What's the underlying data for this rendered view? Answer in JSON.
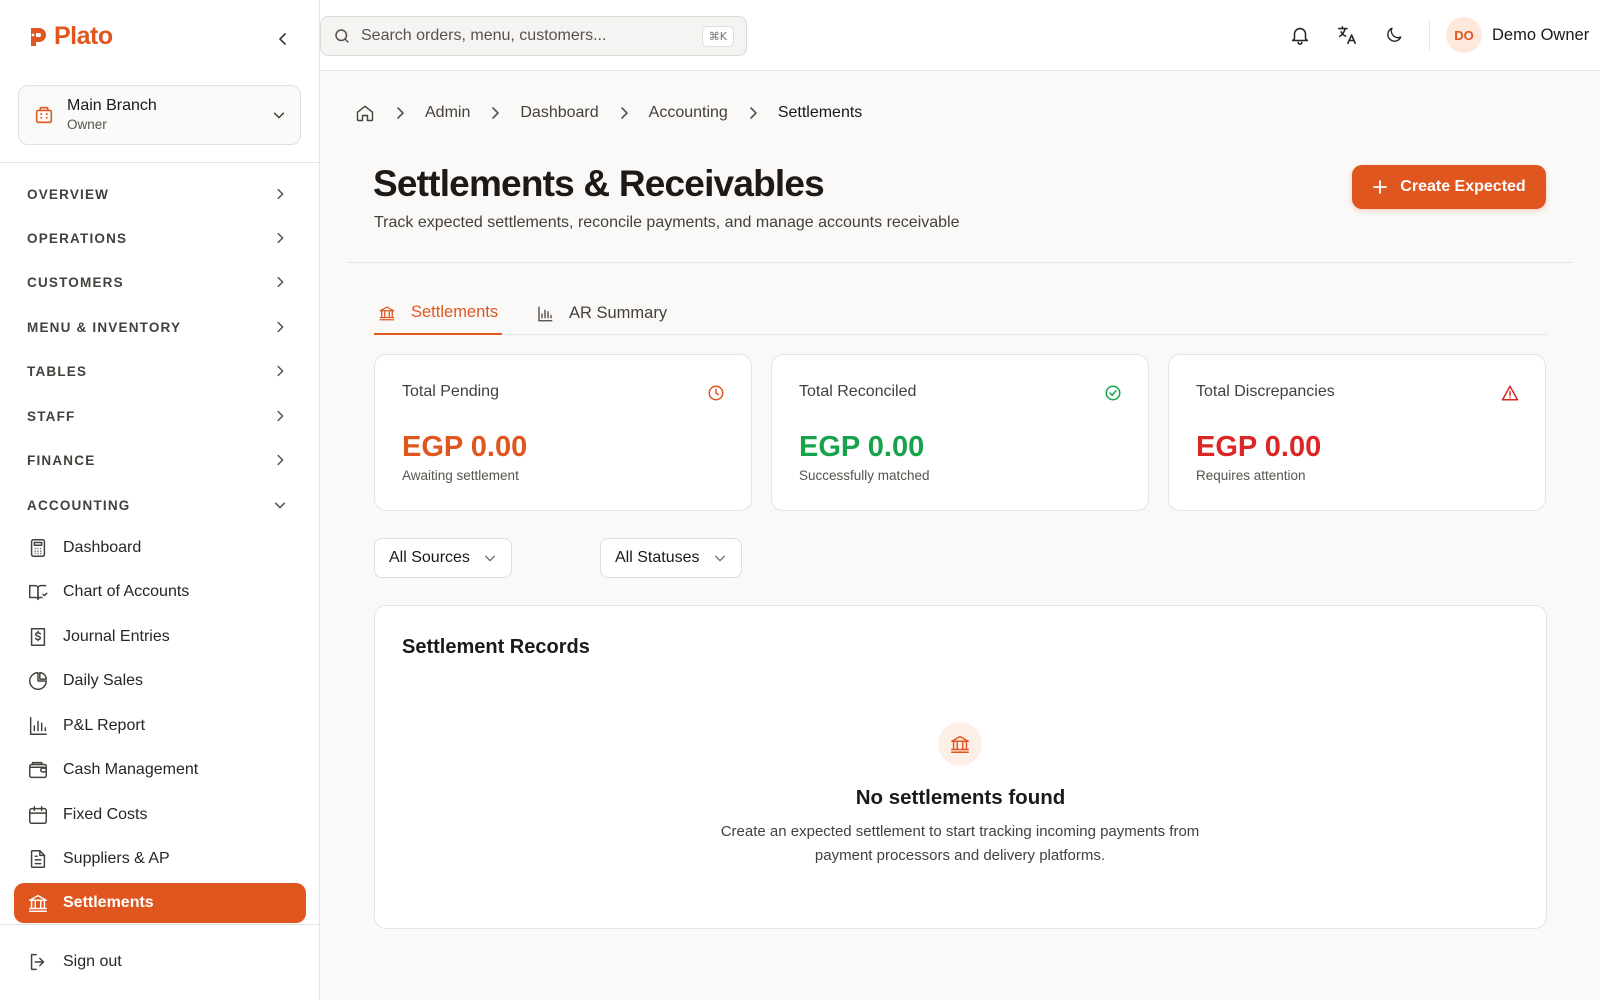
{
  "brand": {
    "name": "Plato",
    "accent": "#e0561f"
  },
  "branch": {
    "name": "Main Branch",
    "role": "Owner"
  },
  "sidebar": {
    "sections": [
      {
        "label": "OVERVIEW",
        "expanded": false
      },
      {
        "label": "OPERATIONS",
        "expanded": false
      },
      {
        "label": "CUSTOMERS",
        "expanded": false
      },
      {
        "label": "MENU & INVENTORY",
        "expanded": false
      },
      {
        "label": "TABLES",
        "expanded": false
      },
      {
        "label": "STAFF",
        "expanded": false
      },
      {
        "label": "FINANCE",
        "expanded": false
      },
      {
        "label": "ACCOUNTING",
        "expanded": true
      }
    ],
    "items": [
      {
        "label": "Dashboard",
        "icon": "calculator-icon"
      },
      {
        "label": "Chart of Accounts",
        "icon": "book-open-icon"
      },
      {
        "label": "Journal Entries",
        "icon": "receipt-dollar-icon"
      },
      {
        "label": "Daily Sales",
        "icon": "pie-chart-icon"
      },
      {
        "label": "P&L Report",
        "icon": "bar-chart-icon"
      },
      {
        "label": "Cash Management",
        "icon": "wallet-icon"
      },
      {
        "label": "Fixed Costs",
        "icon": "calendar-icon"
      },
      {
        "label": "Suppliers & AP",
        "icon": "document-icon"
      },
      {
        "label": "Settlements",
        "icon": "bank-icon",
        "active": true
      }
    ],
    "signout": "Sign out"
  },
  "topbar": {
    "search_placeholder": "Search orders, menu, customers...",
    "search_shortcut": "⌘K",
    "user": {
      "initials": "DO",
      "name": "Demo Owner"
    }
  },
  "breadcrumb": [
    "Admin",
    "Dashboard",
    "Accounting",
    "Settlements"
  ],
  "page": {
    "title": "Settlements & Receivables",
    "subtitle": "Track expected settlements, reconcile payments, and manage accounts receivable",
    "create_button": "Create Expected"
  },
  "tabs": [
    {
      "label": "Settlements",
      "active": true
    },
    {
      "label": "AR Summary",
      "active": false
    }
  ],
  "stats": [
    {
      "label": "Total Pending",
      "value": "EGP 0.00",
      "sub": "Awaiting settlement",
      "color": "#e0561f",
      "icon": "clock-icon"
    },
    {
      "label": "Total Reconciled",
      "value": "EGP 0.00",
      "sub": "Successfully matched",
      "color": "#16a34a",
      "icon": "check-circle-icon"
    },
    {
      "label": "Total Discrepancies",
      "value": "EGP 0.00",
      "sub": "Requires attention",
      "color": "#dc2626",
      "icon": "alert-triangle-icon"
    }
  ],
  "filters": {
    "sources": {
      "selected": "All Sources"
    },
    "statuses": {
      "selected": "All Statuses"
    }
  },
  "records": {
    "title": "Settlement Records",
    "empty_title": "No settlements found",
    "empty_desc": "Create an expected settlement to start tracking incoming payments from payment processors and delivery platforms."
  }
}
